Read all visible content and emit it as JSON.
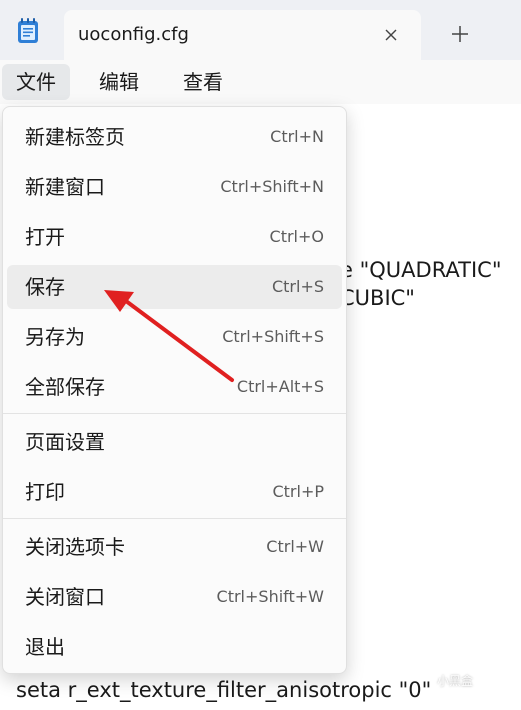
{
  "tab": {
    "title": "uoconfig.cfg",
    "close_icon": "close-icon",
    "new_tab_icon": "plus-icon"
  },
  "menubar": {
    "items": [
      {
        "label": "文件",
        "active": true
      },
      {
        "label": "编辑",
        "active": false
      },
      {
        "label": "查看",
        "active": false
      }
    ]
  },
  "editor": {
    "partial_line_1": "e \"QUADRATIC\"",
    "partial_line_2": "CUBIC\"",
    "bottom_line": "seta r_ext_texture_filter_anisotropic \"0\""
  },
  "file_menu": {
    "groups": [
      [
        {
          "label": "新建标签页",
          "shortcut": "Ctrl+N"
        },
        {
          "label": "新建窗口",
          "shortcut": "Ctrl+Shift+N"
        },
        {
          "label": "打开",
          "shortcut": "Ctrl+O"
        },
        {
          "label": "保存",
          "shortcut": "Ctrl+S",
          "highlighted": true
        },
        {
          "label": "另存为",
          "shortcut": "Ctrl+Shift+S"
        },
        {
          "label": "全部保存",
          "shortcut": "Ctrl+Alt+S"
        }
      ],
      [
        {
          "label": "页面设置",
          "shortcut": ""
        },
        {
          "label": "打印",
          "shortcut": "Ctrl+P"
        }
      ],
      [
        {
          "label": "关闭选项卡",
          "shortcut": "Ctrl+W"
        },
        {
          "label": "关闭窗口",
          "shortcut": "Ctrl+Shift+W"
        },
        {
          "label": "退出",
          "shortcut": ""
        }
      ]
    ]
  },
  "annotation": {
    "arrow_color": "#e02020"
  },
  "watermark": {
    "text": "小黑盒"
  },
  "colors": {
    "titlebar": "#eef0f4",
    "menu_hover": "#ececec",
    "icon_blue": "#2f7fd6"
  }
}
